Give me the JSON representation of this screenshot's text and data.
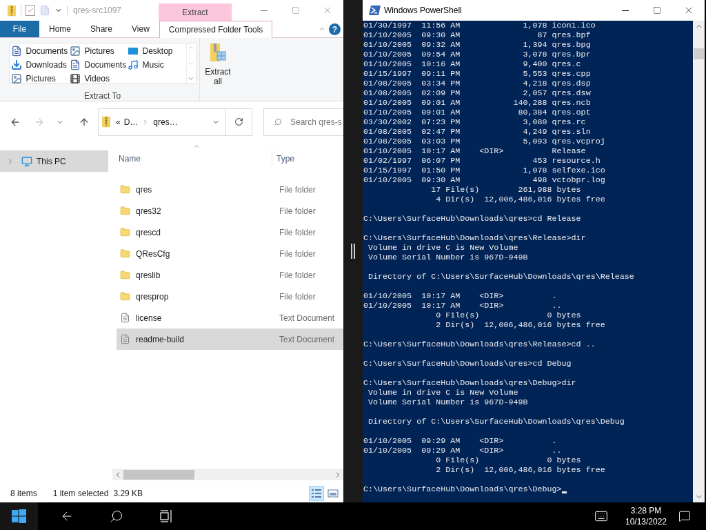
{
  "explorer": {
    "title": "qres-src1097",
    "context_tab": "Extract",
    "ribbon_tabs": [
      {
        "label": "File",
        "kind": "file",
        "selected": false
      },
      {
        "label": "Home",
        "kind": "tab",
        "selected": false
      },
      {
        "label": "Share",
        "kind": "tab",
        "selected": false
      },
      {
        "label": "View",
        "kind": "tab",
        "selected": false
      },
      {
        "label": "Compressed Folder Tools",
        "kind": "tab",
        "selected": true
      }
    ],
    "gallery": [
      {
        "label": "Documents",
        "kind": "documents"
      },
      {
        "label": "Pictures",
        "kind": "pictures"
      },
      {
        "label": "Desktop",
        "kind": "desktop"
      },
      {
        "label": "Downloads",
        "kind": "downloads"
      },
      {
        "label": "Documents",
        "kind": "documents"
      },
      {
        "label": "Music",
        "kind": "music"
      },
      {
        "label": "Pictures",
        "kind": "pictures"
      },
      {
        "label": "Videos",
        "kind": "videos"
      }
    ],
    "help": "?",
    "group_label": "Extract To",
    "extract_all": "Extract all",
    "address": {
      "overflow": "«",
      "crumbs": [
        "D…",
        "qres…"
      ]
    },
    "search": {
      "placeholder": "Search qres-s"
    },
    "nav": [
      {
        "label": "This PC",
        "selected": true,
        "expanded": false
      }
    ],
    "columns": [
      "Name",
      "Type"
    ],
    "files": [
      {
        "name": "qres",
        "type": "File folder",
        "kind": "folder",
        "selected": false
      },
      {
        "name": "qres32",
        "type": "File folder",
        "kind": "folder",
        "selected": false
      },
      {
        "name": "qrescd",
        "type": "File folder",
        "kind": "folder",
        "selected": false
      },
      {
        "name": "QResCfg",
        "type": "File folder",
        "kind": "folder",
        "selected": false
      },
      {
        "name": "qreslib",
        "type": "File folder",
        "kind": "folder",
        "selected": false
      },
      {
        "name": "qresprop",
        "type": "File folder",
        "kind": "folder",
        "selected": false
      },
      {
        "name": "license",
        "type": "Text Document",
        "kind": "text",
        "selected": false
      },
      {
        "name": "readme-build",
        "type": "Text Document",
        "kind": "text",
        "selected": true
      }
    ],
    "status": {
      "count": "8 items",
      "selection": "1 item selected",
      "size": "3.29 KB"
    },
    "views": [
      {
        "kind": "details",
        "selected": true
      },
      {
        "kind": "tiles",
        "selected": false
      }
    ]
  },
  "powershell": {
    "title": "Windows PowerShell",
    "cursor_visible": true,
    "blocks": [
      [
        "01/30/1997  11:56 AM             1,078 icon1.ico",
        "01/10/2005  09:30 AM                87 qres.bpf",
        "01/10/2005  09:32 AM             1,394 qres.bpg",
        "01/10/2005  09:54 AM             3,078 qres.bpr",
        "01/10/2005  10:16 AM             9,400 qres.c",
        "01/15/1997  09:11 PM             5,553 qres.cpp",
        "01/08/2005  03:34 PM             4,218 qres.dsp",
        "01/08/2005  02:09 PM             2,057 qres.dsw",
        "01/10/2005  09:01 AM           140,288 qres.ncb",
        "01/10/2005  09:01 AM            80,384 qres.opt",
        "03/30/2002  07:23 PM             3,080 qres.rc",
        "01/08/2005  02:47 PM             4,249 qres.sln",
        "01/08/2005  03:03 PM             5,093 qres.vcproj",
        "01/10/2005  10:17 AM    <DIR>          Release",
        "01/02/1997  06:07 PM               453 resource.h",
        "01/15/1997  01:50 PM             1,078 selfexe.ico",
        "01/10/2005  09:30 AM               498 vctobpr.log",
        "              17 File(s)        261,988 bytes",
        "               4 Dir(s)  12,006,486,016 bytes free"
      ],
      [
        "C:\\Users\\SurfaceHub\\Downloads\\qres>cd Release"
      ],
      [
        "C:\\Users\\SurfaceHub\\Downloads\\qres\\Release>dir",
        " Volume in drive C is New Volume",
        " Volume Serial Number is 967D-949B"
      ],
      [
        " Directory of C:\\Users\\SurfaceHub\\Downloads\\qres\\Release"
      ],
      [
        "01/10/2005  10:17 AM    <DIR>          .",
        "01/10/2005  10:17 AM    <DIR>          ..",
        "               0 File(s)              0 bytes",
        "               2 Dir(s)  12,006,486,016 bytes free"
      ],
      [
        "C:\\Users\\SurfaceHub\\Downloads\\qres\\Release>cd .."
      ],
      [
        "C:\\Users\\SurfaceHub\\Downloads\\qres>cd Debug"
      ],
      [
        "C:\\Users\\SurfaceHub\\Downloads\\qres\\Debug>dir",
        " Volume in drive C is New Volume",
        " Volume Serial Number is 967D-949B"
      ],
      [
        " Directory of C:\\Users\\SurfaceHub\\Downloads\\qres\\Debug"
      ],
      [
        "01/10/2005  09:29 AM    <DIR>          .",
        "01/10/2005  09:29 AM    <DIR>          ..",
        "               0 File(s)              0 bytes",
        "               2 Dir(s)  12,006,486,016 bytes free"
      ],
      [
        "C:\\Users\\SurfaceHub\\Downloads\\qres\\Debug>"
      ]
    ]
  },
  "taskbar": {
    "time": "3:28 PM",
    "date": "10/13/2022"
  }
}
